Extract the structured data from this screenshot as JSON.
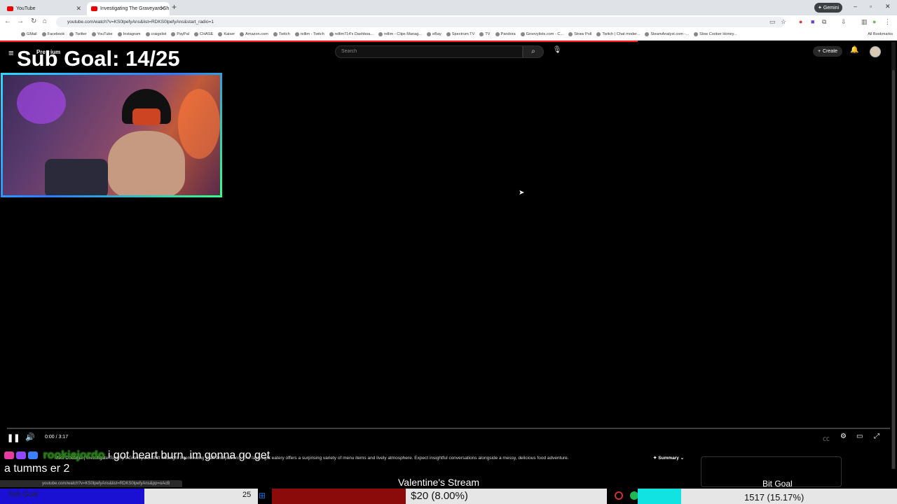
{
  "browser": {
    "tabs": [
      {
        "label": "YouTube",
        "active": false
      },
      {
        "label": "Investigating The Graveyard Sh",
        "active": true
      }
    ],
    "url": "youtube.com/watch?v=KS0lpefyAns&list=RDKS0lpefyAns&start_radio=1",
    "gemini_label": "Gemini",
    "bookmarks": [
      "GMail",
      "Facebook",
      "Twitter",
      "YouTube",
      "Instagram",
      "craigslist",
      "PayPal",
      "CHASE",
      "Kaiser",
      "Amazon.com",
      "Twitch",
      "rellim - Twitch",
      "rellim714's Dashboa...",
      "rellim - Clips Manag...",
      "eBay",
      "Spectrum TV",
      "TV",
      "Pandora",
      "Groovylists.com - C...",
      "Straw Poll",
      "Twitch | Chat moder...",
      "SteamAnalyst.com -...",
      "Slow Cooker Honey..."
    ],
    "all_bookmarks_label": "All Bookmarks"
  },
  "youtube": {
    "logo_text": "Premium",
    "search_placeholder": "Search",
    "create_label": "Create",
    "time": "0:00 / 3:17",
    "description": "Mike Doubtful | Investigate Tommy's Graveyard Shift Midnight Interviewing Staff and patrons. The late-night eatery offers a surprising variety of menu items and lively atmosphere. Expect insightful conversations alongside a messy, delicious food adventure.",
    "summary_label": "Summary"
  },
  "overlay": {
    "sub_goal_title": "Sub Goal: 14/25",
    "chat": {
      "username": "rookiejordo",
      "message": "i got heart burn, im gonna go get a tumms er 2"
    },
    "status_url": "youtube.com/watch?v=KS0lpefyAns&list=RDKS0lpefyAns&pp=oAcB",
    "valentine_label": "Valentine's Stream",
    "bit_goal_title": "Bit Goal",
    "bars": {
      "sub_label": "Sub Goal",
      "sub_value": "25",
      "sub_progress": 0.56,
      "donation_label": "$20 (8.00%)",
      "donation_progress": 0.08,
      "bits_label": "1517 (15.17%)",
      "bits_progress": 0.1517
    }
  },
  "colors": {
    "sub_bar": "#1a10d4",
    "donation_bar": "#8b0a0a",
    "bits_bar": "#11e3e3",
    "youtube_red": "#ff0000"
  }
}
